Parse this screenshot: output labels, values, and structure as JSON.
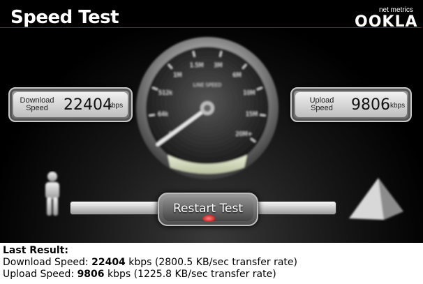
{
  "header": {
    "title": "Speed Test",
    "brand_small": "net metrics",
    "brand": "OOKLA"
  },
  "gauge": {
    "center_label": "LINE SPEED",
    "ticks": [
      "0",
      "64k",
      "512k",
      "1M",
      "1.5M",
      "3M",
      "6M",
      "10M",
      "15M",
      "20M+"
    ]
  },
  "download": {
    "label_line1": "Download",
    "label_line2": "Speed",
    "value": "22404",
    "unit": "kbps"
  },
  "upload": {
    "label_line1": "Upload",
    "label_line2": "Speed",
    "value": "9806",
    "unit": "kbps"
  },
  "controls": {
    "restart_label": "Restart Test"
  },
  "last_result": {
    "heading": "Last Result:",
    "download_prefix": "Download Speed: ",
    "download_value": "22404",
    "download_suffix": " kbps (2800.5 KB/sec transfer rate)",
    "upload_prefix": "Upload Speed: ",
    "upload_value": "9806",
    "upload_suffix": " kbps (1225.8 KB/sec transfer rate)"
  }
}
